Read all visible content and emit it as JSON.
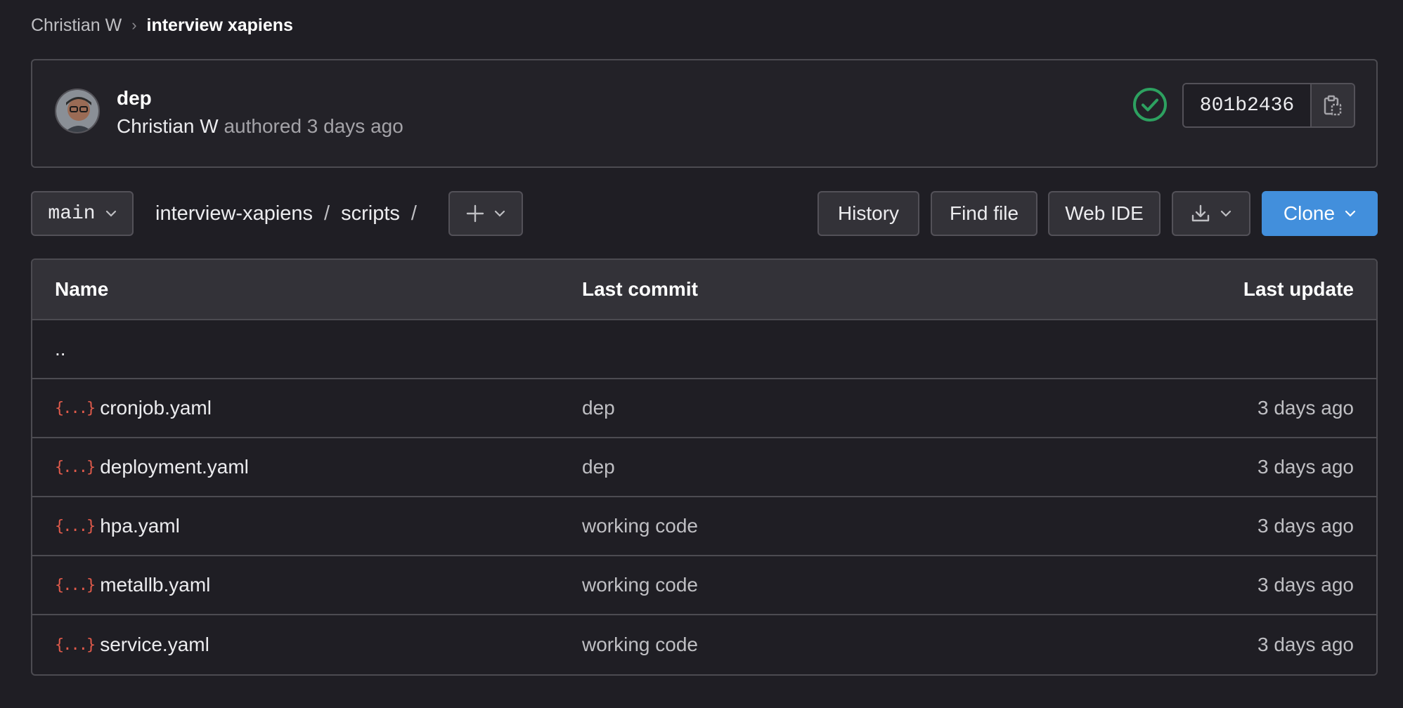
{
  "breadcrumb": {
    "parent": "Christian W",
    "separator": "›",
    "current": "interview xapiens"
  },
  "commit": {
    "title": "dep",
    "author": "Christian W",
    "authored_text": "authored 3 days ago",
    "sha": "801b2436",
    "status": "passed",
    "avatar_icon": "avatar-photo",
    "copy_icon": "clipboard-icon",
    "status_color": "#2da160"
  },
  "toolbar": {
    "branch": "main",
    "path": [
      "interview-xapiens",
      "scripts"
    ],
    "path_sep": "/",
    "add_icon": "plus-icon",
    "history": "History",
    "find_file": "Find file",
    "web_ide": "Web IDE",
    "download_icon": "download-icon",
    "clone": "Clone",
    "accent": "#428fdc"
  },
  "table": {
    "headers": {
      "name": "Name",
      "last_commit": "Last commit",
      "last_update": "Last update"
    },
    "parent_dir": "..",
    "file_icon": "{...}",
    "file_icon_color": "#e05a4b",
    "rows": [
      {
        "name": "cronjob.yaml",
        "commit": "dep",
        "updated": "3 days ago"
      },
      {
        "name": "deployment.yaml",
        "commit": "dep",
        "updated": "3 days ago"
      },
      {
        "name": "hpa.yaml",
        "commit": "working code",
        "updated": "3 days ago"
      },
      {
        "name": "metallb.yaml",
        "commit": "working code",
        "updated": "3 days ago"
      },
      {
        "name": "service.yaml",
        "commit": "working code",
        "updated": "3 days ago"
      }
    ]
  }
}
